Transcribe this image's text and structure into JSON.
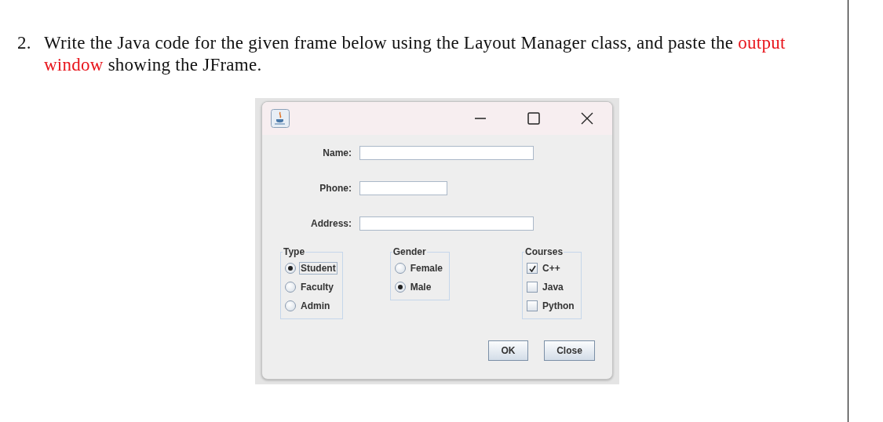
{
  "question": {
    "number": "2.",
    "lines": [
      [
        {
          "text": "Write the Java code for the given frame below using the Layout Manager class, and paste the ",
          "highlight": false
        },
        {
          "text": "output",
          "highlight": true
        }
      ],
      [
        {
          "text": "window",
          "highlight": true
        },
        {
          "text": " showing the JFrame.",
          "highlight": false
        }
      ]
    ]
  },
  "frame": {
    "fields": [
      {
        "label": "Name:",
        "kind": "wide"
      },
      {
        "label": "Phone:",
        "kind": "narrow"
      },
      {
        "label": "Address:",
        "kind": "wide"
      }
    ],
    "groups": [
      {
        "title": "Type",
        "kind": "radio",
        "options": [
          {
            "label": "Student",
            "selected": true,
            "focused": true
          },
          {
            "label": "Faculty",
            "selected": false,
            "focused": false
          },
          {
            "label": "Admin",
            "selected": false,
            "focused": false
          }
        ]
      },
      {
        "title": "Gender",
        "kind": "radio",
        "options": [
          {
            "label": "Female",
            "selected": false,
            "focused": false
          },
          {
            "label": "Male",
            "selected": true,
            "focused": false
          }
        ]
      },
      {
        "title": "Courses",
        "kind": "checkbox",
        "options": [
          {
            "label": "C++",
            "checked": true,
            "focused": false
          },
          {
            "label": "Java",
            "checked": false,
            "focused": false
          },
          {
            "label": "Python",
            "checked": false,
            "focused": false
          }
        ]
      }
    ],
    "buttons": [
      "OK",
      "Close"
    ]
  }
}
